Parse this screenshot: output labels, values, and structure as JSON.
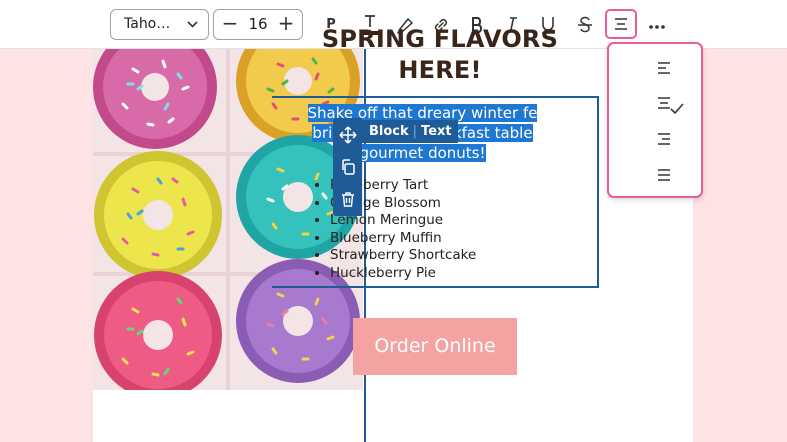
{
  "toolbar": {
    "font_family": "Taho…",
    "font_size": "16",
    "paragraph_label": "P"
  },
  "align_menu": {
    "options": [
      "Align left",
      "Align center",
      "Align right",
      "Justify"
    ],
    "selected": "Align center"
  },
  "block_badge": {
    "type": "Block",
    "name": "Text"
  },
  "content": {
    "headline_line1": "SPRING FLAVORS",
    "headline_line2": "HERE!",
    "intro_line1": "Shake off that dreary winter fe",
    "intro_line2": "brighten your breakfast table",
    "intro_line3": "gourmet donuts!",
    "flavors": [
      "Raspberry Tart",
      "Orange Blossom",
      "Lemon Meringue",
      "Blueberry Muffin",
      "Strawberry Shortcake",
      "Huckleberry Pie"
    ],
    "order_button": "Order Online"
  },
  "colors": {
    "accent_pink": "#e85d9b",
    "selection_blue": "#1e78d2",
    "block_blue": "#1f5b96",
    "button_pink": "#f4a2a2",
    "page_background": "#fde3e3"
  }
}
